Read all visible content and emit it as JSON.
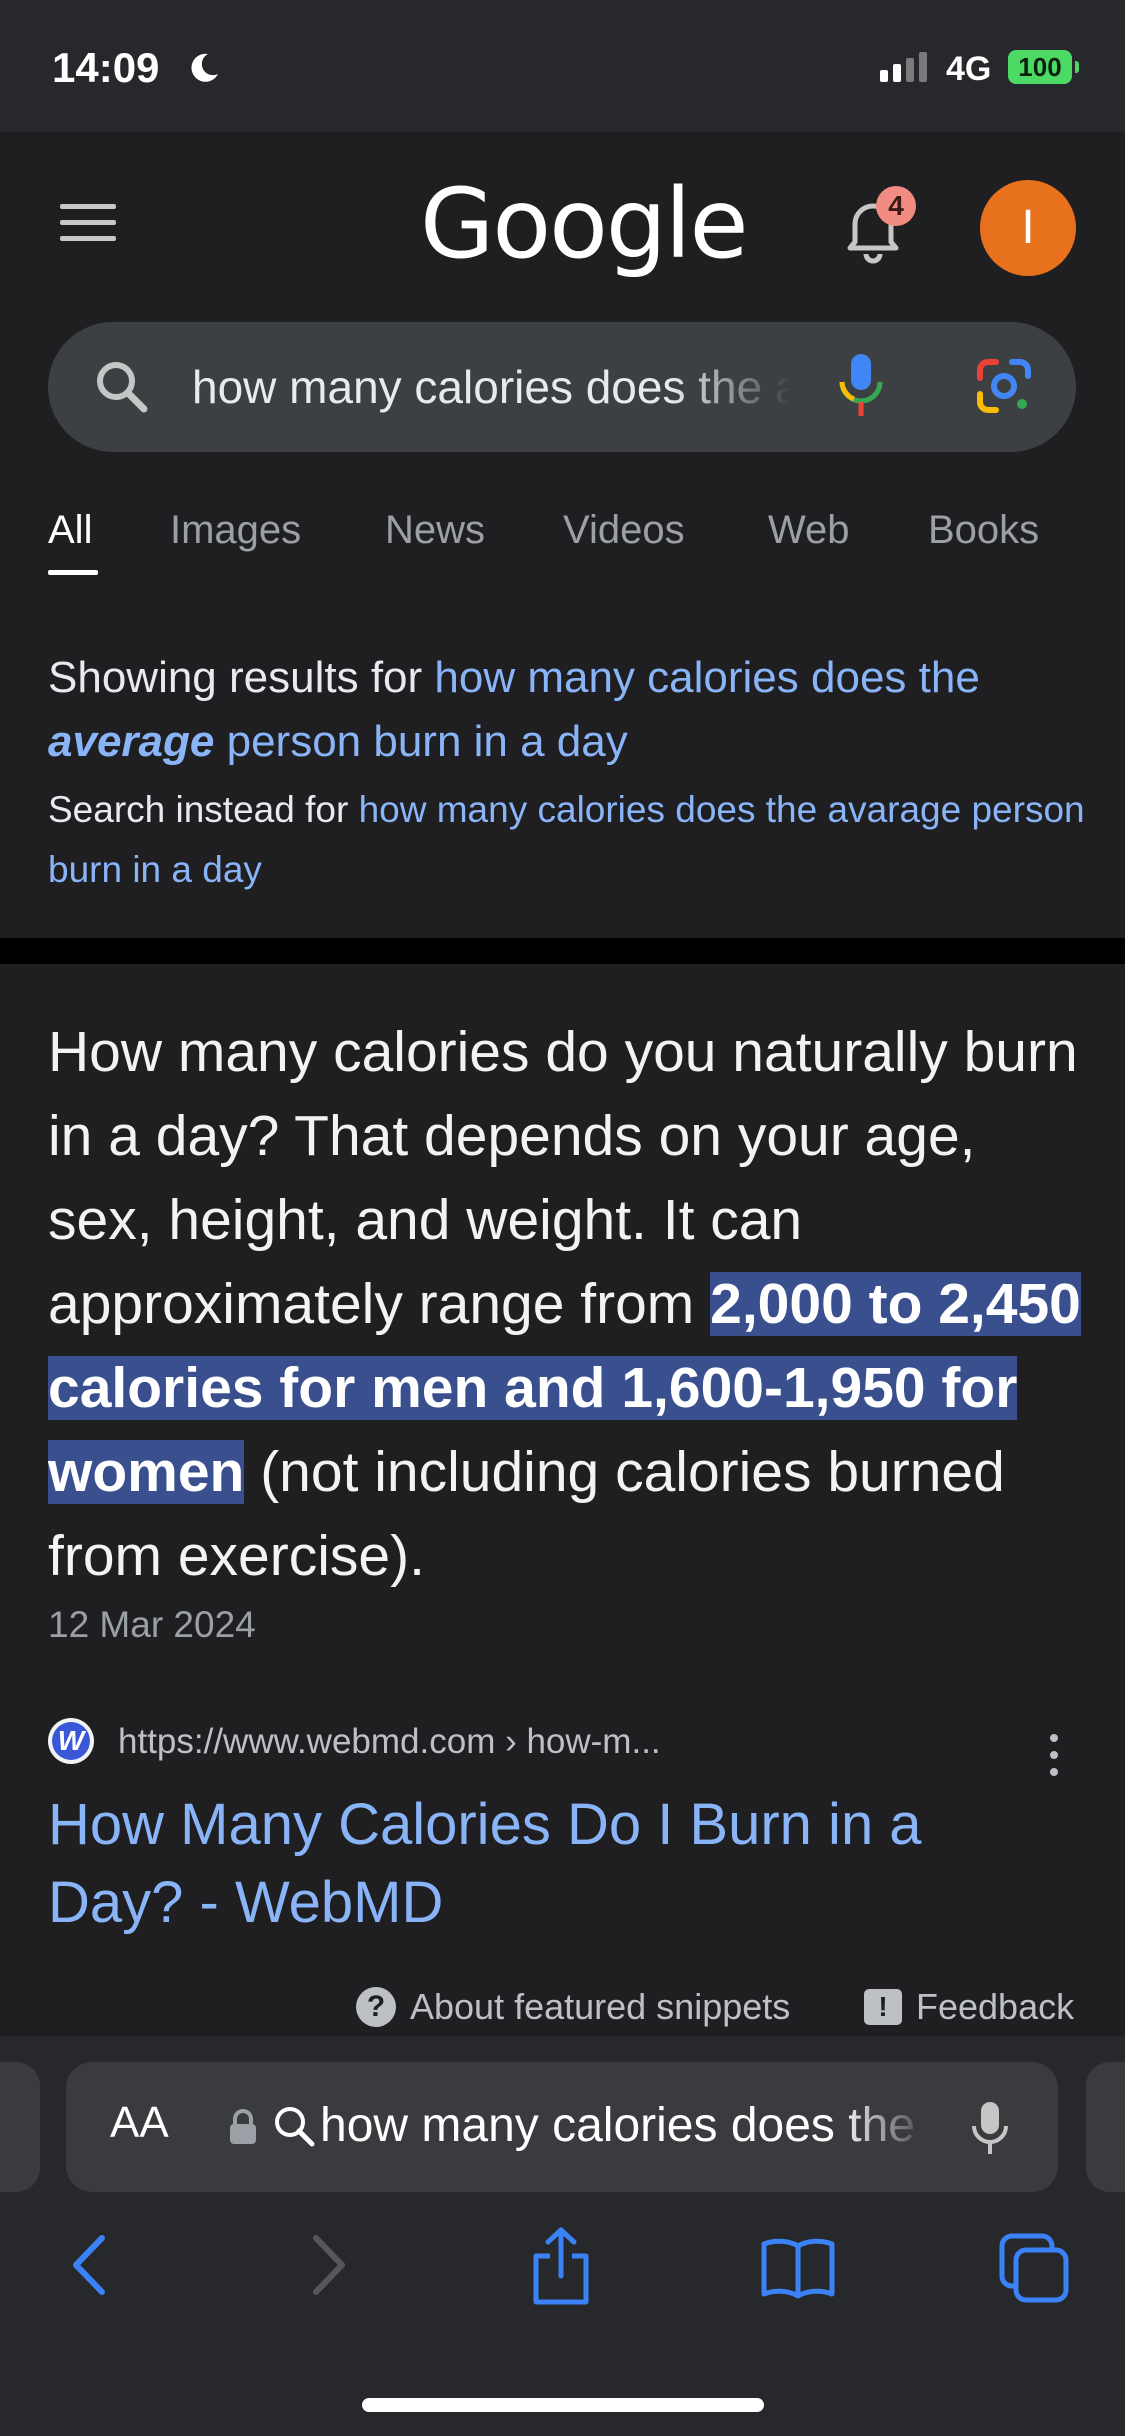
{
  "status_bar": {
    "time": "14:09",
    "network": "4G",
    "battery": "100"
  },
  "header": {
    "logo": "Google",
    "notification_count": "4",
    "avatar_letter": "I"
  },
  "search": {
    "query": "how many calories does the average person burn in a day"
  },
  "tabs": [
    {
      "label": "All",
      "active": true
    },
    {
      "label": "Images"
    },
    {
      "label": "News"
    },
    {
      "label": "Videos"
    },
    {
      "label": "Web"
    },
    {
      "label": "Books"
    }
  ],
  "correction": {
    "showing_prefix": "Showing results for",
    "showing_pre": "how many calories does the",
    "showing_emph": "average",
    "showing_post": "person burn in a day",
    "instead_prefix": "Search instead for",
    "instead_query": "how many calories does the avarage person burn in a day"
  },
  "snippet": {
    "text_before": "How many calories do you naturally burn in a day? That depends on your age, sex, height, and weight. It can approximately range from ",
    "highlight": "2,000 to 2,450 calories for men and 1,600-1,950 for women",
    "text_after": " (not including calories burned from exercise).",
    "date": "12 Mar 2024"
  },
  "result": {
    "favicon_letter": "W",
    "url": "https://www.webmd.com › how-m...",
    "title": "How Many Calories Do I Burn in a Day? - WebMD"
  },
  "footer_links": {
    "about": "About featured snippets",
    "feedback": "Feedback"
  },
  "safari": {
    "aa_label": "AA",
    "address": "how many calories does the average person burn in a day"
  },
  "colors": {
    "link": "#8ab4f8",
    "highlight_bg": "#394f8e",
    "avatar": "#e8711e",
    "battery": "#4cd964"
  }
}
